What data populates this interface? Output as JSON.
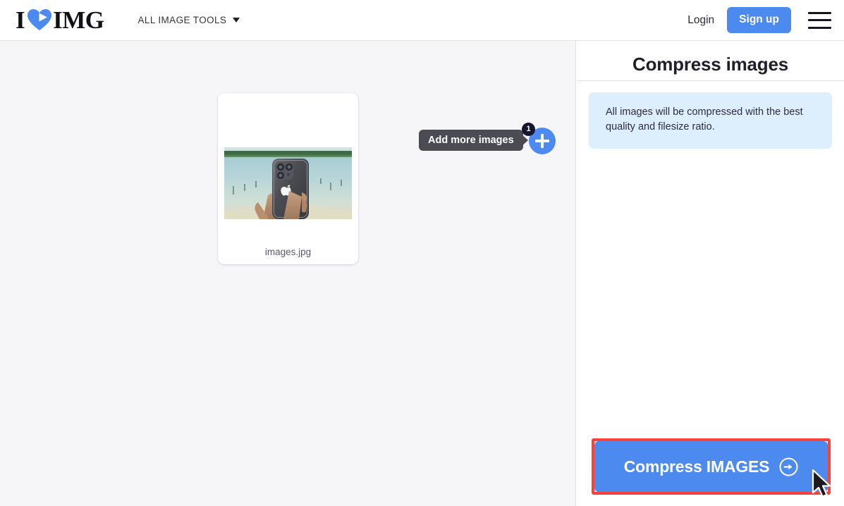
{
  "header": {
    "logo": {
      "left_text": "I",
      "right_text": "IMG",
      "heart_icon": "heart-icon",
      "heart_color": "#4d8af0"
    },
    "nav": {
      "all_tools_label": "ALL IMAGE TOOLS",
      "caret_icon": "chevron-down-icon"
    },
    "login_label": "Login",
    "signup_label": "Sign up",
    "menu_icon": "hamburger-menu-icon"
  },
  "workspace": {
    "file_card": {
      "file_name": "images.jpg",
      "thumbnail_alt": "hand-holding-iphone-at-lake"
    },
    "add_more": {
      "tooltip_label": "Add more images",
      "badge_count": "1",
      "plus_icon": "plus-icon"
    }
  },
  "panel": {
    "title": "Compress images",
    "info_text": "All images will be compressed with the best quality and filesize ratio.",
    "action_button": {
      "label": "Compress IMAGES",
      "icon": "arrow-right-circle-icon",
      "highlighted": "true"
    }
  },
  "colors": {
    "brand_blue": "#4d8af0",
    "info_blue": "#ddeefd",
    "workspace_bg": "#f6f6f9",
    "tooltip_bg": "#4b4b53",
    "badge_bg": "#15152b",
    "highlight_red": "#f9423a"
  },
  "cursor": {
    "icon": "mouse-pointer-icon"
  }
}
